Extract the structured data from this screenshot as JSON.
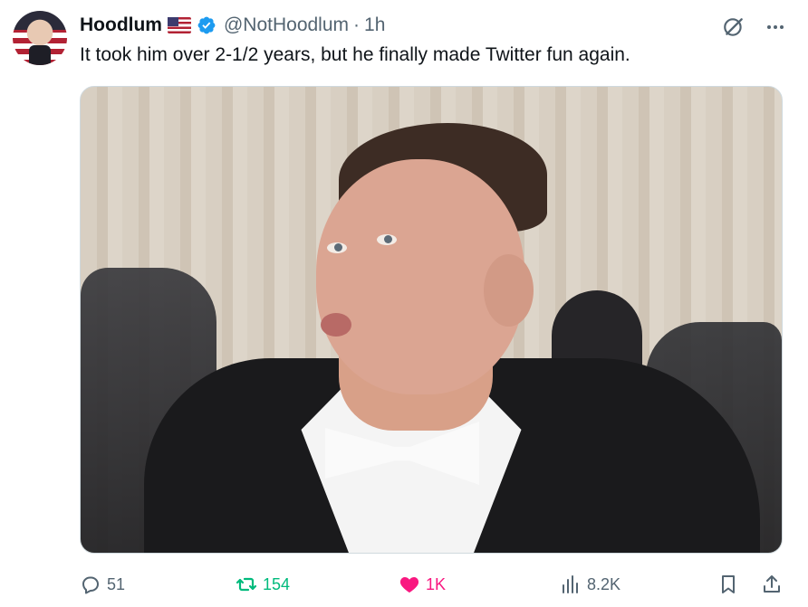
{
  "author": {
    "name": "Hoodlum",
    "handle": "@NotHoodlum",
    "separator": "·",
    "time": "1h",
    "flag_icon": "us-flag-icon",
    "verified_color": "#1d9bf0"
  },
  "tweet": {
    "text": "It took him over 2-1/2 years, but he finally made Twitter fun again."
  },
  "stats": {
    "replies": "51",
    "retweets": "154",
    "likes": "1K",
    "views": "8.2K"
  },
  "colors": {
    "retweet": "#00ba7c",
    "like": "#f91880",
    "muted": "#536471"
  }
}
